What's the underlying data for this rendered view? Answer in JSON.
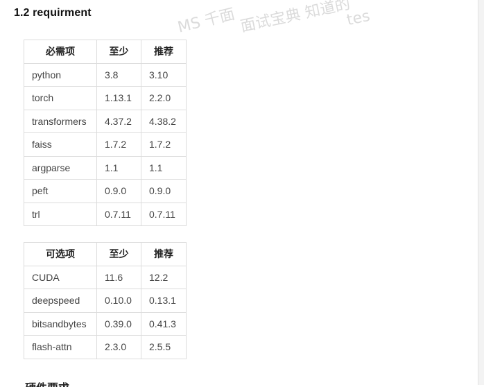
{
  "section": {
    "heading": "1.2 requirment"
  },
  "watermark": {
    "parts": [
      "MS 千面",
      "面试宝典 知道的",
      "tes"
    ]
  },
  "required_table": {
    "headers": [
      "必需项",
      "至少",
      "推荐"
    ],
    "rows": [
      [
        "python",
        "3.8",
        "3.10"
      ],
      [
        "torch",
        "1.13.1",
        "2.2.0"
      ],
      [
        "transformers",
        "4.37.2",
        "4.38.2"
      ],
      [
        "faiss",
        "1.7.2",
        "1.7.2"
      ],
      [
        "argparse",
        "1.1",
        "1.1"
      ],
      [
        "peft",
        "0.9.0",
        "0.9.0"
      ],
      [
        "trl",
        "0.7.11",
        "0.7.11"
      ]
    ]
  },
  "optional_table": {
    "headers": [
      "可选项",
      "至少",
      "推荐"
    ],
    "rows": [
      [
        "CUDA",
        "11.6",
        "12.2"
      ],
      [
        "deepspeed",
        "0.10.0",
        "0.13.1"
      ],
      [
        "bitsandbytes",
        "0.39.0",
        "0.41.3"
      ],
      [
        "flash-attn",
        "2.3.0",
        "2.5.5"
      ]
    ]
  },
  "next_heading_partial": "硬件要求"
}
